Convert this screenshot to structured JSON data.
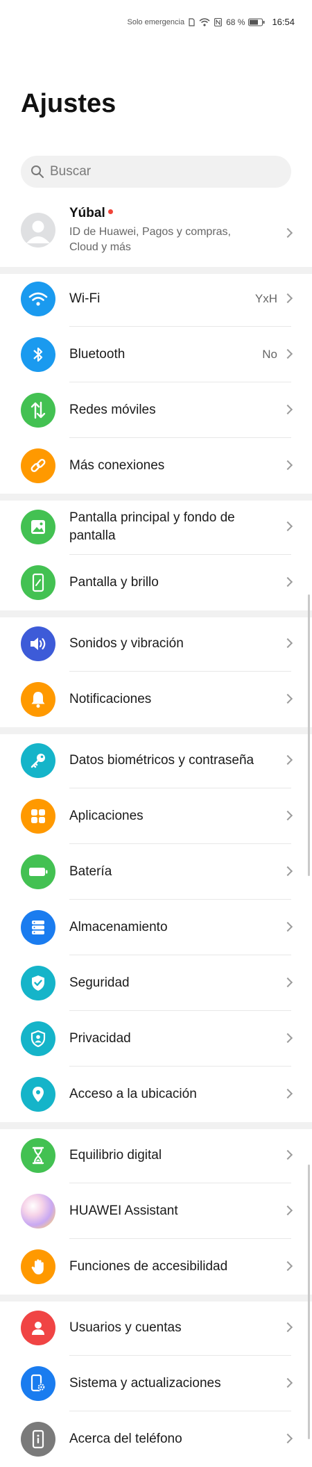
{
  "status_bar": {
    "emergency": "Solo emergencia",
    "battery": "68 %",
    "time": "16:54"
  },
  "page_title": "Ajustes",
  "search": {
    "placeholder": "Buscar"
  },
  "account": {
    "name": "Yúbal",
    "subtitle": "ID de Huawei, Pagos y compras, Cloud y más"
  },
  "items": [
    {
      "label": "Wi-Fi",
      "value": "YxH",
      "color": "#1a9aef",
      "icon": "wifi-icon"
    },
    {
      "label": "Bluetooth",
      "value": "No",
      "color": "#1a9aef",
      "icon": "bluetooth-icon"
    },
    {
      "label": "Redes móviles",
      "value": "",
      "color": "#43c152",
      "icon": "mobile-network-icon"
    },
    {
      "label": "Más conexiones",
      "value": "",
      "color": "#ff9900",
      "icon": "link-icon"
    },
    {
      "label": "Pantalla principal y fondo de pantalla",
      "value": "",
      "color": "#43c152",
      "icon": "image-icon"
    },
    {
      "label": "Pantalla y brillo",
      "value": "",
      "color": "#43c152",
      "icon": "phone-brightness-icon"
    },
    {
      "label": "Sonidos y vibración",
      "value": "",
      "color": "#3d5bd8",
      "icon": "speaker-icon"
    },
    {
      "label": "Notificaciones",
      "value": "",
      "color": "#ff9900",
      "icon": "bell-icon"
    },
    {
      "label": "Datos biométricos y contraseña",
      "value": "",
      "color": "#15b4c9",
      "icon": "key-icon"
    },
    {
      "label": "Aplicaciones",
      "value": "",
      "color": "#ff9900",
      "icon": "apps-grid-icon"
    },
    {
      "label": "Batería",
      "value": "",
      "color": "#43c152",
      "icon": "battery-icon"
    },
    {
      "label": "Almacenamiento",
      "value": "",
      "color": "#1a7cef",
      "icon": "storage-icon"
    },
    {
      "label": "Seguridad",
      "value": "",
      "color": "#15b4c9",
      "icon": "shield-check-icon"
    },
    {
      "label": "Privacidad",
      "value": "",
      "color": "#15b4c9",
      "icon": "privacy-shield-icon"
    },
    {
      "label": "Acceso a la ubicación",
      "value": "",
      "color": "#15b4c9",
      "icon": "location-pin-icon"
    },
    {
      "label": "Equilibrio digital",
      "value": "",
      "color": "#43c152",
      "icon": "hourglass-icon"
    },
    {
      "label": "HUAWEI Assistant",
      "value": "",
      "color": "#e0a8e8",
      "icon": "assistant-orb-icon"
    },
    {
      "label": "Funciones de accesibilidad",
      "value": "",
      "color": "#ff9900",
      "icon": "hand-icon"
    },
    {
      "label": "Usuarios y cuentas",
      "value": "",
      "color": "#f04444",
      "icon": "user-icon"
    },
    {
      "label": "Sistema y actualizaciones",
      "value": "",
      "color": "#1a7cef",
      "icon": "phone-settings-icon"
    },
    {
      "label": "Acerca del teléfono",
      "value": "",
      "color": "#7a7a7a",
      "icon": "phone-info-icon"
    }
  ]
}
